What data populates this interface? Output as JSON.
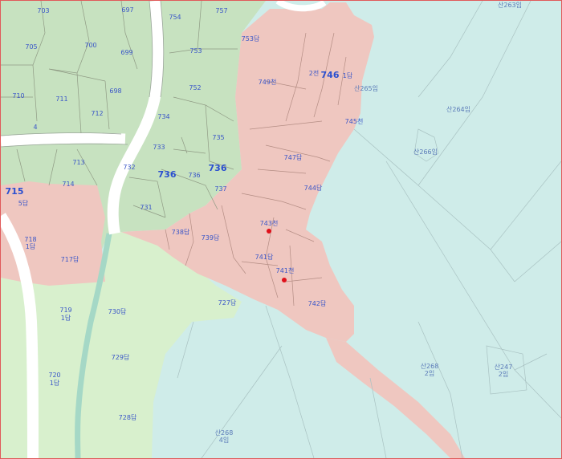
{
  "colors": {
    "sea": "#cfece9",
    "forest": "#c7e2c0",
    "field": "#d8f0cd",
    "site": "#efc7c0",
    "road": "#ffffff",
    "stream": "#a5d8c6",
    "marker": "#e0101a",
    "label": "#3a56c8",
    "frame": "#e05a5a"
  },
  "labels": {
    "l703": "703",
    "l697": "697",
    "l754": "754",
    "l757": "757",
    "l705": "705",
    "l700": "700",
    "l699": "699",
    "l753d": "753답",
    "l753": "753",
    "l749": "749천",
    "l2d": "2전",
    "l746": "746",
    "l1d": "1답",
    "l710": "710",
    "l711": "711",
    "l698": "698",
    "l752": "752",
    "san265": "산265임",
    "l712": "712",
    "l734": "734",
    "l4": "4",
    "l745": "745천",
    "san264": "산264임",
    "l735": "735",
    "l733": "733",
    "l747": "747답",
    "l713": "713",
    "l732": "732",
    "san266": "산266임",
    "l736b": "736",
    "l736": "736",
    "l736s": "736",
    "l714": "714",
    "l737": "737",
    "l744": "744답",
    "l715": "715",
    "l5": "5답",
    "l731": "731",
    "l743": "743천",
    "l738": "738답",
    "l739": "739답",
    "l718a": "718",
    "l718b": "1답",
    "l717": "717답",
    "l741": "741답",
    "l741c": "741천",
    "l742": "742답",
    "l727": "727답",
    "l719a": "719",
    "l719b": "1답",
    "l730d": "730답",
    "l729": "729답",
    "san268a": "산268",
    "san268b": "2임",
    "san247a": "산247",
    "san247b": "2임",
    "l720a": "720",
    "l720b": "1답",
    "l728": "728답",
    "san268c": "산268",
    "san268d": "4임",
    "san263": "산263임"
  }
}
